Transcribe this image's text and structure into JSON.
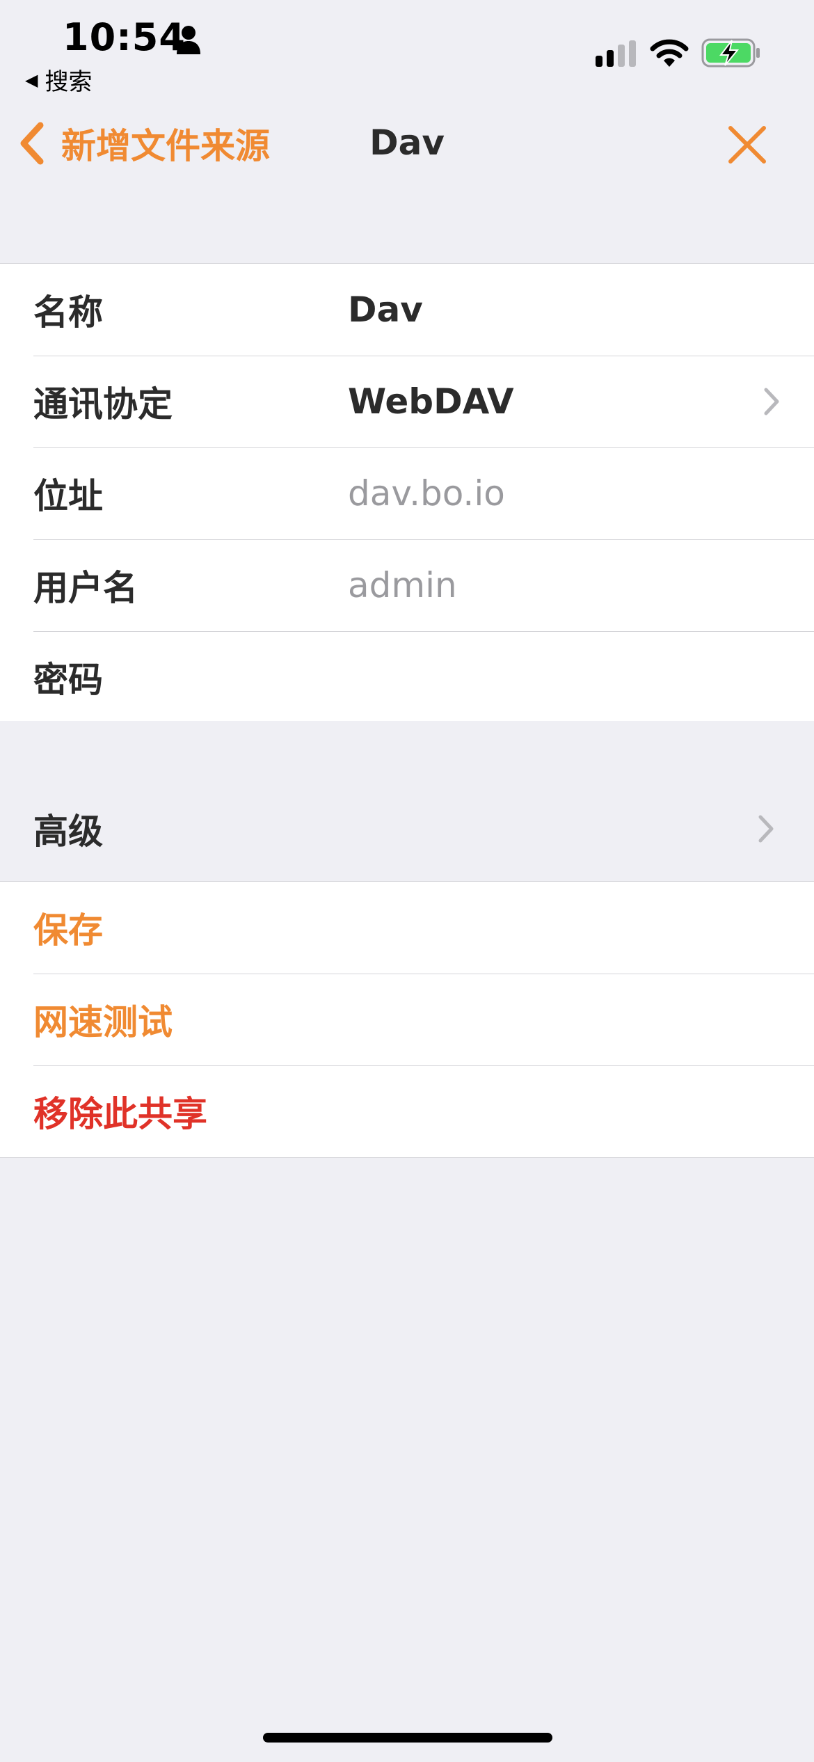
{
  "status_bar": {
    "time": "10:54",
    "back_app_label": "搜索",
    "icons": [
      "person-icon",
      "cellular-signal-icon",
      "wifi-icon",
      "battery-charging-icon"
    ]
  },
  "nav": {
    "back_label": "新增文件来源",
    "title": "Dav"
  },
  "form": {
    "rows": [
      {
        "label": "名称",
        "value": "Dav",
        "placeholder": false
      },
      {
        "label": "通讯协定",
        "value": "WebDAV",
        "placeholder": false
      },
      {
        "label": "位址",
        "value": "dav.bo.io",
        "placeholder": true
      },
      {
        "label": "用户名",
        "value": "admin",
        "placeholder": true
      },
      {
        "label": "密码",
        "value": "",
        "placeholder": false
      }
    ]
  },
  "advanced": {
    "label": "高级"
  },
  "actions": {
    "save": "保存",
    "speed_test": "网速测试",
    "remove_share": "移除此共享"
  },
  "colors": {
    "accent": "#f08a32",
    "destructive": "#e03228",
    "background": "#efeff4",
    "placeholder": "#9a9a9e"
  }
}
